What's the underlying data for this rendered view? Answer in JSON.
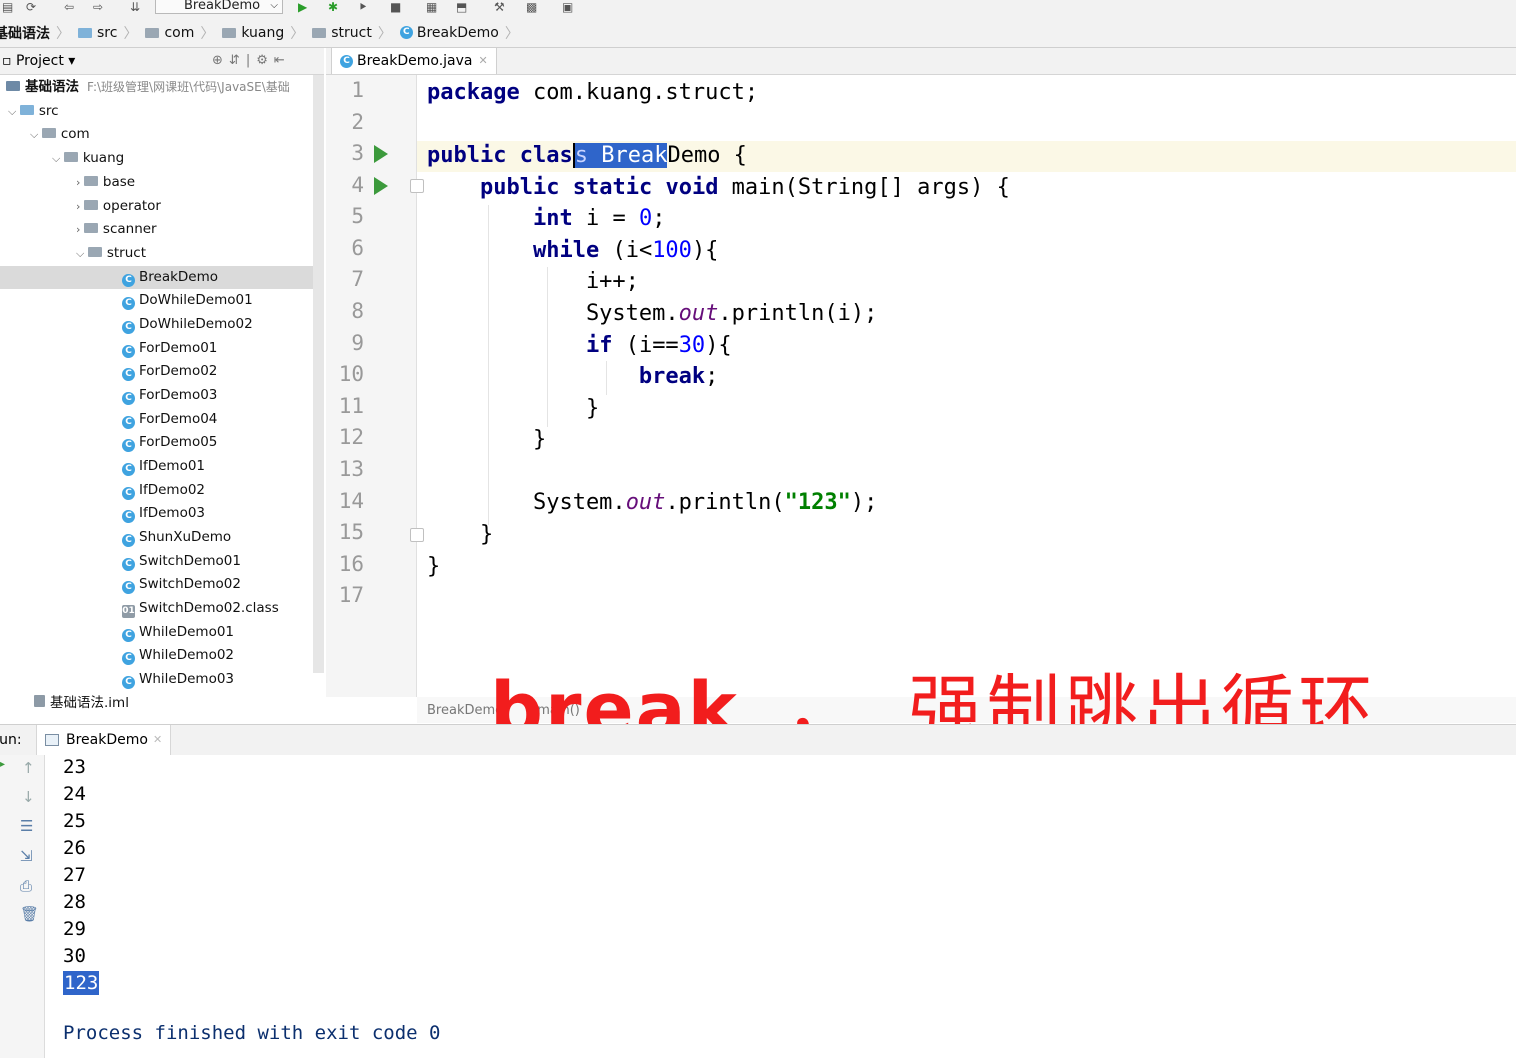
{
  "toolbar": {
    "run_config": "BreakDemo"
  },
  "breadcrumb": [
    "基础语法",
    "src",
    "com",
    "kuang",
    "struct",
    "BreakDemo"
  ],
  "project_panel": {
    "title": "Project"
  },
  "tree": {
    "root_label": "基础语法",
    "root_path": "F:\\班级管理\\网课班\\代码\\JavaSE\\基础",
    "src": "src",
    "com": "com",
    "kuang": "kuang",
    "packages": [
      "base",
      "operator",
      "scanner",
      "struct"
    ],
    "files": [
      "BreakDemo",
      "DoWhileDemo01",
      "DoWhileDemo02",
      "ForDemo01",
      "ForDemo02",
      "ForDemo03",
      "ForDemo04",
      "ForDemo05",
      "IfDemo01",
      "IfDemo02",
      "IfDemo03",
      "ShunXuDemo",
      "SwitchDemo01",
      "SwitchDemo02",
      "SwitchDemo02.class",
      "WhileDemo01",
      "WhileDemo02",
      "WhileDemo03"
    ],
    "iml": "基础语法.iml"
  },
  "editor": {
    "tab": "BreakDemo.java",
    "line_numbers": [
      "1",
      "2",
      "3",
      "4",
      "5",
      "6",
      "7",
      "8",
      "9",
      "10",
      "11",
      "12",
      "13",
      "14",
      "15",
      "16",
      "17"
    ],
    "footer": "BreakDemo",
    "footer_method": "main()"
  },
  "caption": {
    "keyword": "break",
    "comma": "，",
    "text": "强制跳出循环"
  },
  "run": {
    "label": "Run:",
    "tab": "BreakDemo",
    "output": [
      "23",
      "24",
      "25",
      "26",
      "27",
      "28",
      "29",
      "30",
      "123"
    ],
    "process_message": "Process finished with exit code 0"
  }
}
